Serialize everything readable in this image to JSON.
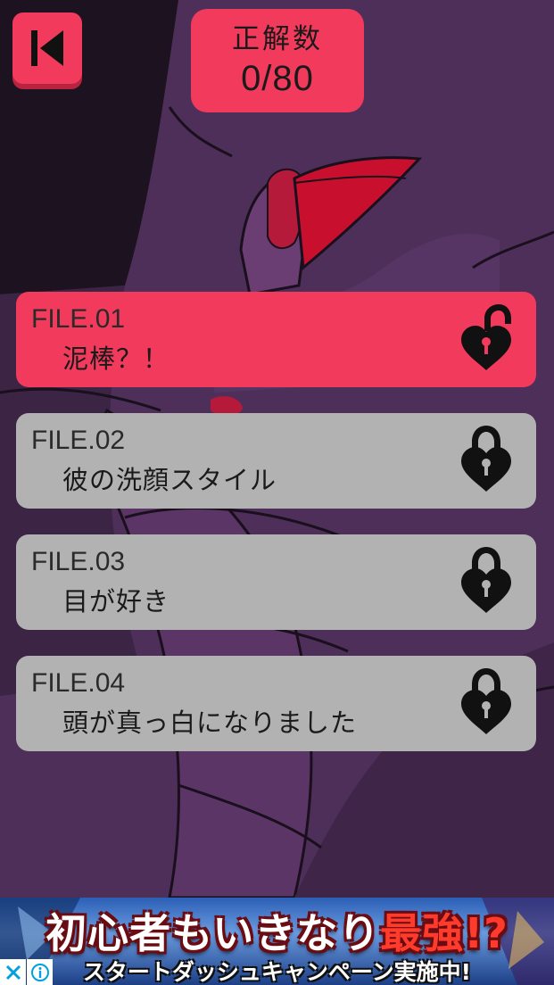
{
  "header": {
    "score_label": "正解数",
    "score_value": "0/80"
  },
  "files": [
    {
      "number": "FILE.01",
      "title": "泥棒？！",
      "status": "unlocked",
      "icon": "heart-padlock-open-icon"
    },
    {
      "number": "FILE.02",
      "title": "彼の洗顔スタイル",
      "status": "locked",
      "icon": "heart-padlock-locked-icon"
    },
    {
      "number": "FILE.03",
      "title": "目が好き",
      "status": "locked",
      "icon": "heart-padlock-locked-icon"
    },
    {
      "number": "FILE.04",
      "title": "頭が真っ白になりました",
      "status": "locked",
      "icon": "heart-padlock-locked-icon"
    }
  ],
  "ad": {
    "headline_main": "初心者もいきなり",
    "headline_accent": "最強!?",
    "subline": "スタートダッシュキャンペーン実施中!",
    "close_icon": "close-icon",
    "info_icon": "info-icon"
  },
  "colors": {
    "accent": "#f23a5c",
    "locked_card": "#b2b2b2",
    "background": "#4a2d55"
  }
}
